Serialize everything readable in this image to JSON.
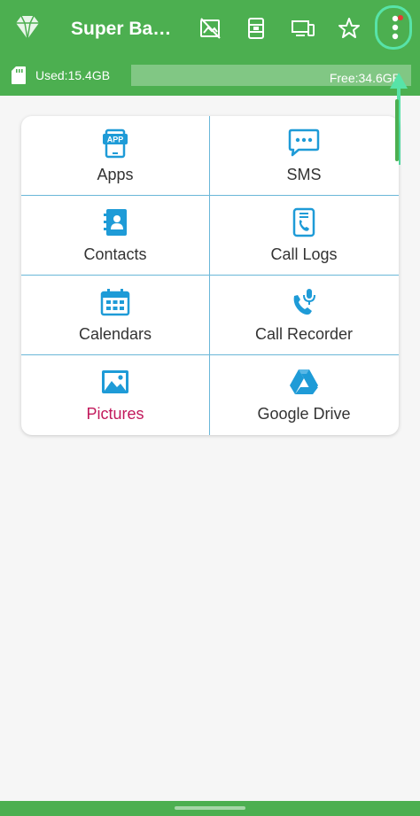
{
  "app": {
    "title": "Super Bac..."
  },
  "toolbar": {
    "icons": [
      "no-photo-icon",
      "sim-card-icon",
      "devices-icon",
      "star-icon",
      "more-vert-icon"
    ]
  },
  "storage": {
    "used_label": "Used:15.4GB",
    "free_label": "Free:34.6GB",
    "used_fraction": 0.31
  },
  "grid": {
    "items": [
      {
        "label": "Apps",
        "icon": "app-icon"
      },
      {
        "label": "SMS",
        "icon": "sms-icon"
      },
      {
        "label": "Contacts",
        "icon": "contacts-icon"
      },
      {
        "label": "Call Logs",
        "icon": "call-logs-icon"
      },
      {
        "label": "Calendars",
        "icon": "calendar-icon"
      },
      {
        "label": "Call Recorder",
        "icon": "call-recorder-icon"
      },
      {
        "label": "Pictures",
        "icon": "pictures-icon"
      },
      {
        "label": "Google Drive",
        "icon": "google-drive-icon"
      }
    ]
  },
  "colors": {
    "appbar": "#4caf50",
    "icon_blue": "#1e9bd7",
    "pictures_label": "#c2185b",
    "annotation": "#57e3a8"
  }
}
